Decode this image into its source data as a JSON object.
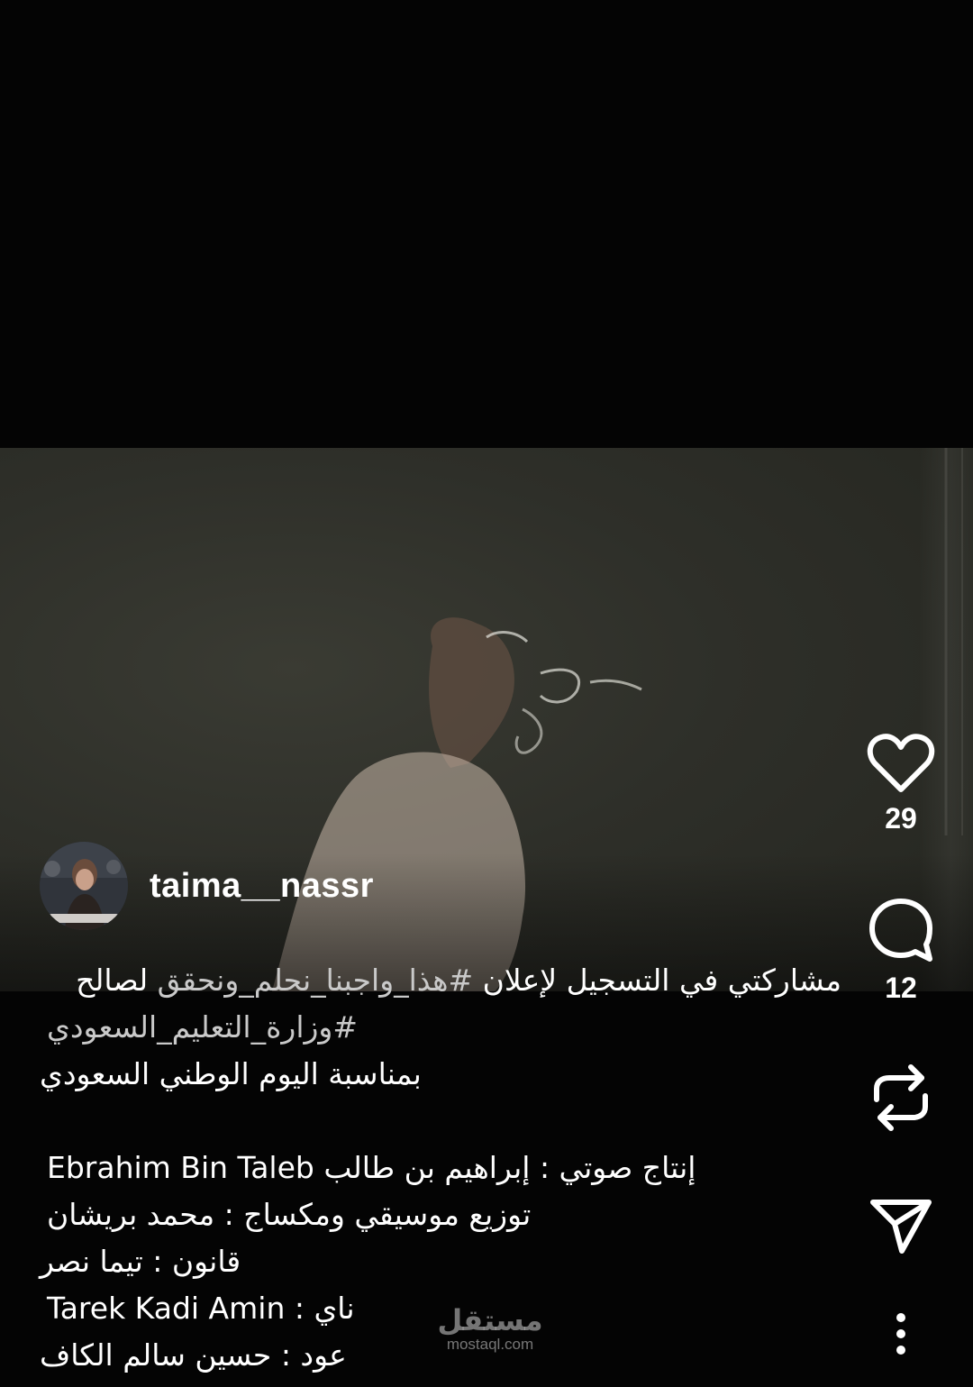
{
  "post": {
    "username": "taima__nassr",
    "likes": "29",
    "comments": "12"
  },
  "caption": {
    "line1_text": "مشاركتي في التسجيل لإعلان ",
    "line1_tag": "#هذا_واجبنا_نحلم_ونحقق",
    "line1_end": " لصالح",
    "line2_tag": "#وزارة_التعليم_السعودي",
    "line3": "بمناسبة اليوم الوطني السعودي",
    "line4": "إنتاج صوتي : إبراهيم بن طالب Ebrahim Bin Taleb",
    "line5": "توزيع موسيقي ومكساج : محمد بريشان",
    "line6": "قانون : تيما نصر",
    "line7": "ناي : Tarek Kadi Amin",
    "line8": "عود : حسين سالم الكاف"
  },
  "watermark": {
    "arabic": "مستقل",
    "latin": "mostaql.com"
  },
  "icons": {
    "like": "heart-icon",
    "comment": "comment-icon",
    "repost": "repost-icon",
    "share": "send-icon",
    "more": "more-vertical-icon"
  }
}
